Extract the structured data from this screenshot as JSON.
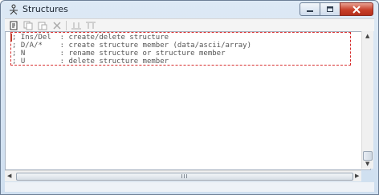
{
  "window": {
    "title": "Structures"
  },
  "caption_buttons": [
    {
      "name": "minimize-button",
      "icon": "minimize-icon"
    },
    {
      "name": "maximize-button",
      "icon": "maximize-icon"
    },
    {
      "name": "close-button",
      "icon": "close-icon"
    }
  ],
  "toolbar": {
    "icons": [
      "new-structure-icon",
      "copy-icon",
      "paste-icon",
      "delete-icon",
      "expand-icon",
      "collapse-icon"
    ]
  },
  "editor": {
    "lines": [
      "; Ins/Del  : create/delete structure",
      "; D/A/*    : create structure member (data/ascii/array)",
      "; N        : rename structure or structure member",
      "; U        : delete structure member"
    ]
  },
  "scrollbar": {
    "thumb_grip": "III"
  },
  "colors": {
    "highlight_border": "#d62b2b",
    "caret": "#c0392b",
    "close_button": "#c8402b"
  }
}
